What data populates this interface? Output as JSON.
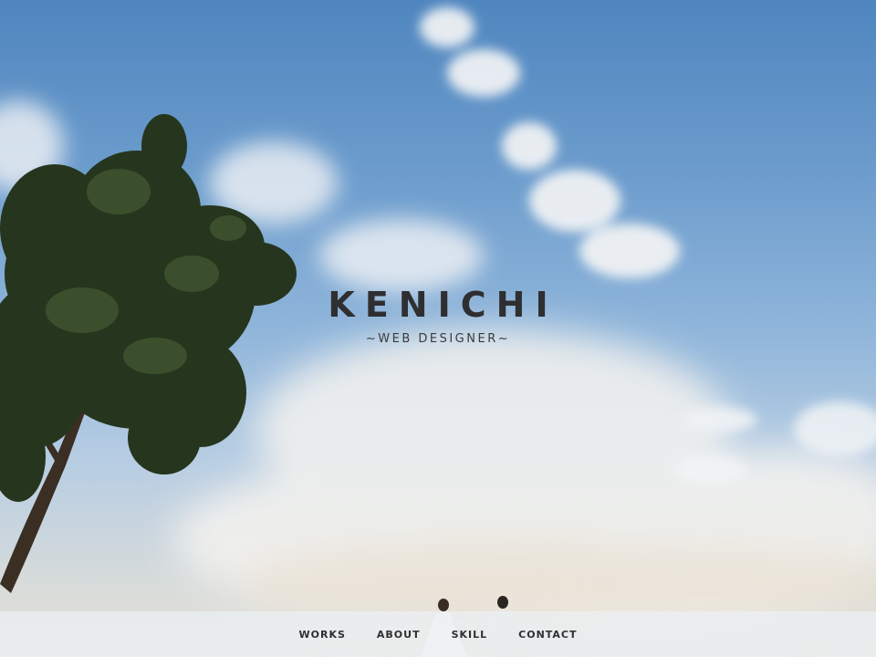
{
  "hero": {
    "title": "KENICHI",
    "tagline": "~WEB DESIGNER~"
  },
  "nav": {
    "items": [
      {
        "id": "works",
        "label": "WORKS"
      },
      {
        "id": "about",
        "label": "ABOUT"
      },
      {
        "id": "skill",
        "label": "SKILL"
      },
      {
        "id": "contact",
        "label": "CONTACT"
      }
    ]
  },
  "colors": {
    "sky": "#6b9bcc",
    "text": "#2f2f31",
    "navbar": "#ebf0f4"
  }
}
